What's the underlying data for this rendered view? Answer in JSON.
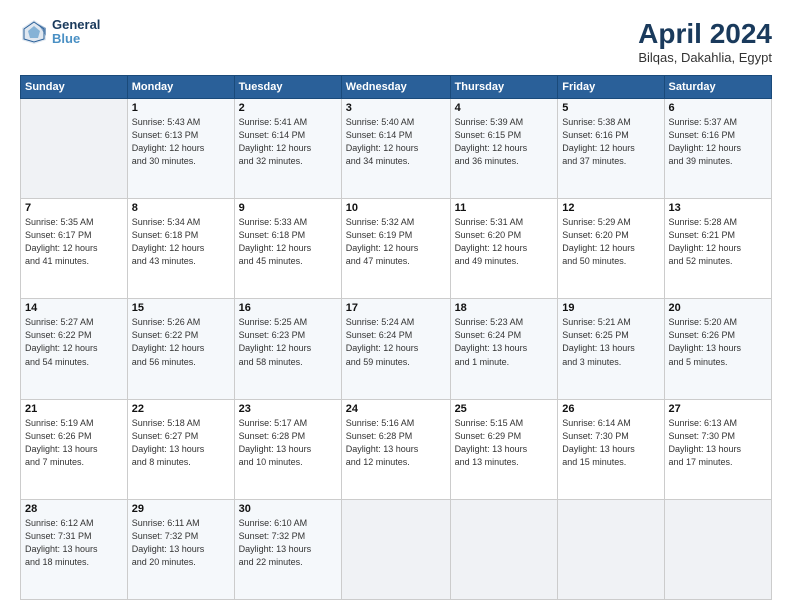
{
  "header": {
    "logo_line1": "General",
    "logo_line2": "Blue",
    "month_year": "April 2024",
    "location": "Bilqas, Dakahlia, Egypt"
  },
  "weekdays": [
    "Sunday",
    "Monday",
    "Tuesday",
    "Wednesday",
    "Thursday",
    "Friday",
    "Saturday"
  ],
  "weeks": [
    [
      {
        "day": "",
        "info": ""
      },
      {
        "day": "1",
        "info": "Sunrise: 5:43 AM\nSunset: 6:13 PM\nDaylight: 12 hours\nand 30 minutes."
      },
      {
        "day": "2",
        "info": "Sunrise: 5:41 AM\nSunset: 6:14 PM\nDaylight: 12 hours\nand 32 minutes."
      },
      {
        "day": "3",
        "info": "Sunrise: 5:40 AM\nSunset: 6:14 PM\nDaylight: 12 hours\nand 34 minutes."
      },
      {
        "day": "4",
        "info": "Sunrise: 5:39 AM\nSunset: 6:15 PM\nDaylight: 12 hours\nand 36 minutes."
      },
      {
        "day": "5",
        "info": "Sunrise: 5:38 AM\nSunset: 6:16 PM\nDaylight: 12 hours\nand 37 minutes."
      },
      {
        "day": "6",
        "info": "Sunrise: 5:37 AM\nSunset: 6:16 PM\nDaylight: 12 hours\nand 39 minutes."
      }
    ],
    [
      {
        "day": "7",
        "info": "Sunrise: 5:35 AM\nSunset: 6:17 PM\nDaylight: 12 hours\nand 41 minutes."
      },
      {
        "day": "8",
        "info": "Sunrise: 5:34 AM\nSunset: 6:18 PM\nDaylight: 12 hours\nand 43 minutes."
      },
      {
        "day": "9",
        "info": "Sunrise: 5:33 AM\nSunset: 6:18 PM\nDaylight: 12 hours\nand 45 minutes."
      },
      {
        "day": "10",
        "info": "Sunrise: 5:32 AM\nSunset: 6:19 PM\nDaylight: 12 hours\nand 47 minutes."
      },
      {
        "day": "11",
        "info": "Sunrise: 5:31 AM\nSunset: 6:20 PM\nDaylight: 12 hours\nand 49 minutes."
      },
      {
        "day": "12",
        "info": "Sunrise: 5:29 AM\nSunset: 6:20 PM\nDaylight: 12 hours\nand 50 minutes."
      },
      {
        "day": "13",
        "info": "Sunrise: 5:28 AM\nSunset: 6:21 PM\nDaylight: 12 hours\nand 52 minutes."
      }
    ],
    [
      {
        "day": "14",
        "info": "Sunrise: 5:27 AM\nSunset: 6:22 PM\nDaylight: 12 hours\nand 54 minutes."
      },
      {
        "day": "15",
        "info": "Sunrise: 5:26 AM\nSunset: 6:22 PM\nDaylight: 12 hours\nand 56 minutes."
      },
      {
        "day": "16",
        "info": "Sunrise: 5:25 AM\nSunset: 6:23 PM\nDaylight: 12 hours\nand 58 minutes."
      },
      {
        "day": "17",
        "info": "Sunrise: 5:24 AM\nSunset: 6:24 PM\nDaylight: 12 hours\nand 59 minutes."
      },
      {
        "day": "18",
        "info": "Sunrise: 5:23 AM\nSunset: 6:24 PM\nDaylight: 13 hours\nand 1 minute."
      },
      {
        "day": "19",
        "info": "Sunrise: 5:21 AM\nSunset: 6:25 PM\nDaylight: 13 hours\nand 3 minutes."
      },
      {
        "day": "20",
        "info": "Sunrise: 5:20 AM\nSunset: 6:26 PM\nDaylight: 13 hours\nand 5 minutes."
      }
    ],
    [
      {
        "day": "21",
        "info": "Sunrise: 5:19 AM\nSunset: 6:26 PM\nDaylight: 13 hours\nand 7 minutes."
      },
      {
        "day": "22",
        "info": "Sunrise: 5:18 AM\nSunset: 6:27 PM\nDaylight: 13 hours\nand 8 minutes."
      },
      {
        "day": "23",
        "info": "Sunrise: 5:17 AM\nSunset: 6:28 PM\nDaylight: 13 hours\nand 10 minutes."
      },
      {
        "day": "24",
        "info": "Sunrise: 5:16 AM\nSunset: 6:28 PM\nDaylight: 13 hours\nand 12 minutes."
      },
      {
        "day": "25",
        "info": "Sunrise: 5:15 AM\nSunset: 6:29 PM\nDaylight: 13 hours\nand 13 minutes."
      },
      {
        "day": "26",
        "info": "Sunrise: 6:14 AM\nSunset: 7:30 PM\nDaylight: 13 hours\nand 15 minutes."
      },
      {
        "day": "27",
        "info": "Sunrise: 6:13 AM\nSunset: 7:30 PM\nDaylight: 13 hours\nand 17 minutes."
      }
    ],
    [
      {
        "day": "28",
        "info": "Sunrise: 6:12 AM\nSunset: 7:31 PM\nDaylight: 13 hours\nand 18 minutes."
      },
      {
        "day": "29",
        "info": "Sunrise: 6:11 AM\nSunset: 7:32 PM\nDaylight: 13 hours\nand 20 minutes."
      },
      {
        "day": "30",
        "info": "Sunrise: 6:10 AM\nSunset: 7:32 PM\nDaylight: 13 hours\nand 22 minutes."
      },
      {
        "day": "",
        "info": ""
      },
      {
        "day": "",
        "info": ""
      },
      {
        "day": "",
        "info": ""
      },
      {
        "day": "",
        "info": ""
      }
    ]
  ]
}
